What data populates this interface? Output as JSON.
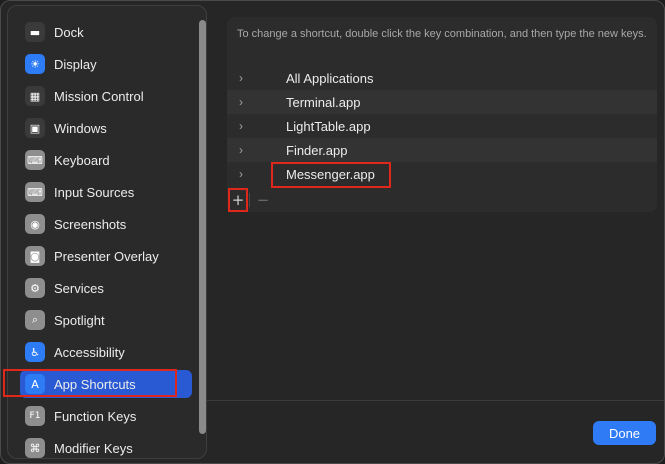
{
  "sidebar": {
    "items": [
      {
        "label": "Dock",
        "icon": "dock-icon",
        "glyph": "▬",
        "color": "#3a3a3a"
      },
      {
        "label": "Display",
        "icon": "display-icon",
        "glyph": "☀",
        "color": "#2d7cf6"
      },
      {
        "label": "Mission Control",
        "icon": "mission-control-icon",
        "glyph": "▦",
        "color": "#3a3a3a"
      },
      {
        "label": "Windows",
        "icon": "windows-icon",
        "glyph": "▣",
        "color": "#3a3a3a"
      },
      {
        "label": "Keyboard",
        "icon": "keyboard-icon",
        "glyph": "⌨",
        "color": "#8e8e8e"
      },
      {
        "label": "Input Sources",
        "icon": "input-sources-icon",
        "glyph": "⌨",
        "color": "#8e8e8e"
      },
      {
        "label": "Screenshots",
        "icon": "screenshots-icon",
        "glyph": "◉",
        "color": "#8e8e8e"
      },
      {
        "label": "Presenter Overlay",
        "icon": "presenter-overlay-icon",
        "glyph": "◙",
        "color": "#8e8e8e"
      },
      {
        "label": "Services",
        "icon": "services-icon",
        "glyph": "⚙",
        "color": "#8e8e8e"
      },
      {
        "label": "Spotlight",
        "icon": "spotlight-icon",
        "glyph": "⌕",
        "color": "#8e8e8e"
      },
      {
        "label": "Accessibility",
        "icon": "accessibility-icon",
        "glyph": "♿",
        "color": "#2d7cf6"
      },
      {
        "label": "App Shortcuts",
        "icon": "app-shortcuts-icon",
        "glyph": "A",
        "color": "#2d7cf6",
        "selected": true
      },
      {
        "label": "Function Keys",
        "icon": "function-keys-icon",
        "glyph": "F1",
        "color": "#8e8e8e"
      },
      {
        "label": "Modifier Keys",
        "icon": "modifier-keys-icon",
        "glyph": "⌘",
        "color": "#8e8e8e"
      }
    ]
  },
  "main": {
    "hint": "To change a shortcut, double click the key combination, and then type the new keys.",
    "apps": [
      {
        "name": "All Applications"
      },
      {
        "name": "Terminal.app"
      },
      {
        "name": "LightTable.app"
      },
      {
        "name": "Finder.app"
      },
      {
        "name": "Messenger.app"
      }
    ],
    "add_label": "+",
    "remove_label": "−"
  },
  "footer": {
    "done_label": "Done"
  },
  "colors": {
    "accent": "#2f7bf6",
    "selection": "#2a5ad3",
    "highlight_box": "#e0271c"
  }
}
